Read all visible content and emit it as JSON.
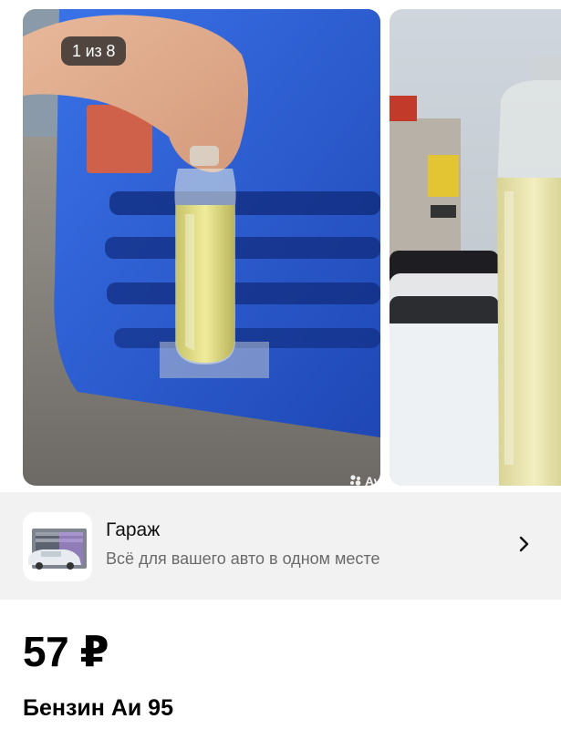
{
  "gallery": {
    "counter": "1 из 8",
    "watermark": "Avito",
    "photo_1_alt": "",
    "photo_2_alt": ""
  },
  "promo": {
    "title": "Гараж",
    "subtitle": "Всё для вашего авто в одном месте",
    "chevron_icon": "chevron-right-icon"
  },
  "listing": {
    "price": "57 ₽",
    "title": "Бензин Аи 95"
  },
  "colors": {
    "promo_bg": "#f2f2f2",
    "truck_blue": "#2a5bd6",
    "fuel_yellow": "#d9d37a"
  }
}
